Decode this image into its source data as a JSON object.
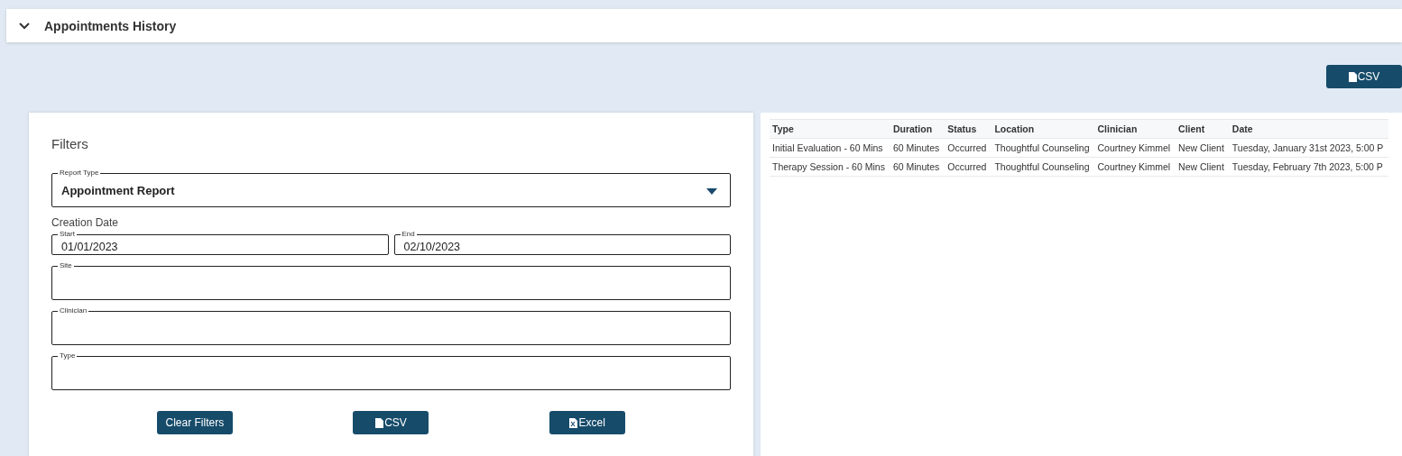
{
  "section": {
    "title": "Appointments History",
    "expanded": true
  },
  "top_button": {
    "label": "CSV",
    "kind": "file"
  },
  "filters": {
    "title": "Filters",
    "report_type": {
      "label": "Report Type",
      "value": "Appointment Report"
    },
    "creation_date": {
      "label": "Creation Date",
      "start": {
        "label": "Start",
        "value": "01/01/2023"
      },
      "end": {
        "label": "End",
        "value": "02/10/2023"
      }
    },
    "fields": [
      {
        "label": "Site"
      },
      {
        "label": "Clinician"
      },
      {
        "label": "Type"
      }
    ],
    "buttons": [
      {
        "label": "Clear Filters",
        "kind": "plain"
      },
      {
        "label": "CSV",
        "kind": "file"
      },
      {
        "label": "Excel",
        "kind": "excel"
      }
    ]
  },
  "table": {
    "columns": [
      "Type",
      "Duration",
      "Status",
      "Location",
      "Clinician",
      "Client",
      "Date"
    ],
    "rows": [
      [
        "Initial Evaluation - 60 Mins",
        "60 Minutes",
        "Occurred",
        "Thoughtful Counseling",
        "Courtney Kimmel",
        "New Client",
        "Tuesday, January 31st 2023, 5:00 P"
      ],
      [
        "Therapy Session - 60 Mins",
        "60 Minutes",
        "Occurred",
        "Thoughtful Counseling",
        "Courtney Kimmel",
        "New Client",
        "Tuesday, February 7th 2023, 5:00 P"
      ]
    ]
  }
}
